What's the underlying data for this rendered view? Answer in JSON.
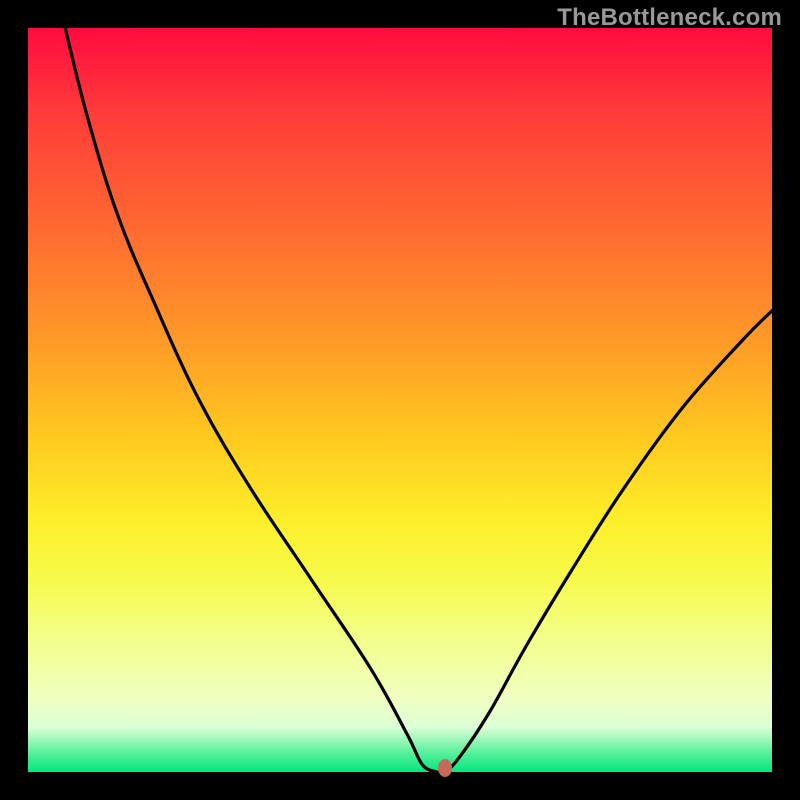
{
  "watermark": "TheBottleneck.com",
  "colors": {
    "frame": "#000000",
    "curve": "#000000",
    "marker": "#c76a5c",
    "gradient_stops": [
      "#ff0b3f",
      "#ff3a3a",
      "#ff6a31",
      "#ff9a28",
      "#ffc91f",
      "#fdee2a",
      "#f7fa4a",
      "#f3ff8a",
      "#f0ffc0",
      "#dcffd6",
      "#55f09a",
      "#05e57f"
    ]
  },
  "chart_data": {
    "type": "line",
    "title": "",
    "xlabel": "",
    "ylabel": "",
    "xlim": [
      0,
      100
    ],
    "ylim": [
      0,
      100
    ],
    "series": [
      {
        "name": "bottleneck-curve",
        "x": [
          5,
          8,
          12,
          17,
          23,
          30,
          38,
          46,
          51,
          53,
          55,
          56,
          58,
          62,
          67,
          73,
          80,
          88,
          96,
          100
        ],
        "values": [
          100,
          88,
          75,
          63,
          50,
          38,
          26,
          14,
          5,
          1,
          0,
          0,
          2,
          8,
          17,
          27,
          38,
          49,
          58,
          62
        ]
      }
    ],
    "marker": {
      "x": 56,
      "y": 0
    },
    "flat_segment": {
      "x_start": 51,
      "x_end": 56,
      "y": 0
    }
  }
}
